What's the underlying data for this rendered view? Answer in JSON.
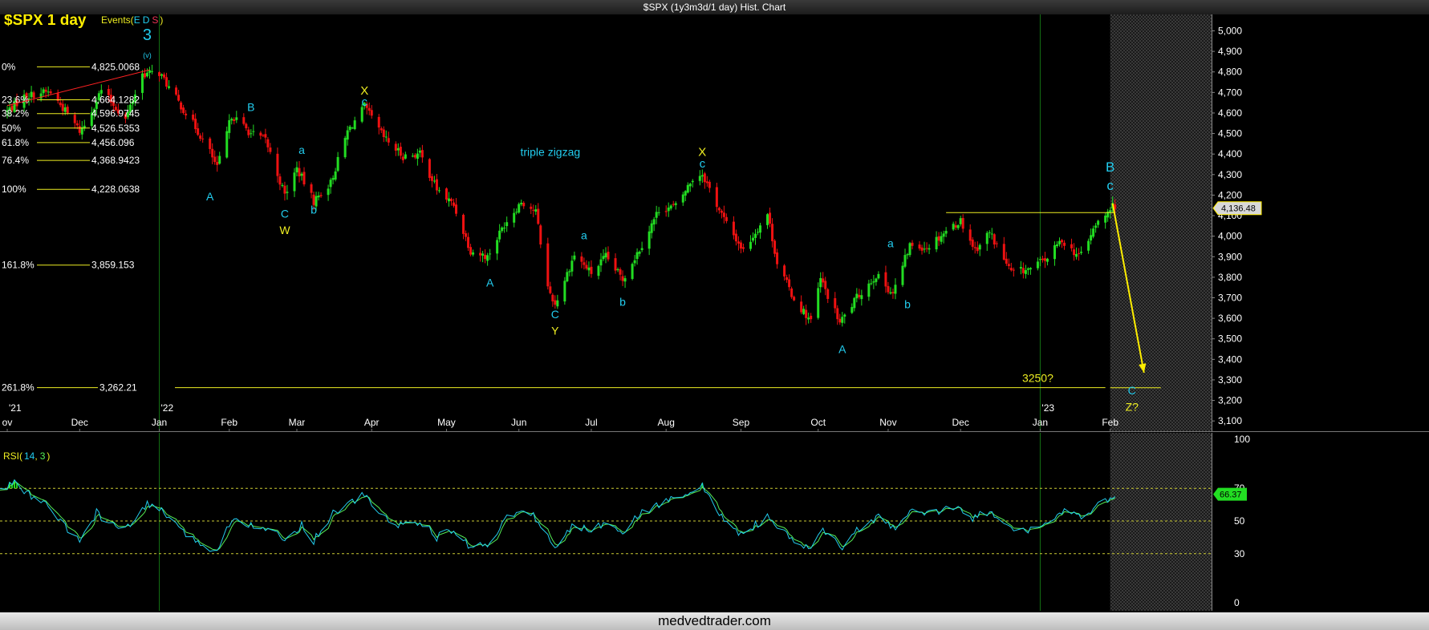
{
  "window": {
    "title": "$SPX (1y3m3d/1 day) Hist. Chart"
  },
  "footer": {
    "text": "medvedtrader.com"
  },
  "colors": {
    "up": "#22dd22",
    "down": "#ee1111",
    "annot_cyan": "#22ccee",
    "annot_yellow": "#eeee22",
    "grid_green": "#137013",
    "rsi_line": "#22ccee",
    "rsi_signal": "#55ee55"
  },
  "chart_data": [
    {
      "type": "candlestick",
      "title": "$SPX 1 day",
      "events_label": {
        "prefix": "Events(",
        "e": "E",
        "d": "D",
        "s": "S",
        "suffix": ")"
      },
      "ylim": [
        3050,
        5080
      ],
      "y_ticks": [
        {
          "value": 5000,
          "label": "5,000"
        },
        {
          "value": 4900,
          "label": "4,900"
        },
        {
          "value": 4800,
          "label": "4,800"
        },
        {
          "value": 4700,
          "label": "4,700"
        },
        {
          "value": 4600,
          "label": "4,600"
        },
        {
          "value": 4500,
          "label": "4,500"
        },
        {
          "value": 4400,
          "label": "4,400"
        },
        {
          "value": 4300,
          "label": "4,300"
        },
        {
          "value": 4200,
          "label": "4,200"
        },
        {
          "value": 4100,
          "label": "4,100"
        },
        {
          "value": 4000,
          "label": "4,000"
        },
        {
          "value": 3900,
          "label": "3,900"
        },
        {
          "value": 3800,
          "label": "3,800"
        },
        {
          "value": 3700,
          "label": "3,700"
        },
        {
          "value": 3600,
          "label": "3,600"
        },
        {
          "value": 3500,
          "label": "3,500"
        },
        {
          "value": 3400,
          "label": "3,400"
        },
        {
          "value": 3300,
          "label": "3,300"
        },
        {
          "value": 3200,
          "label": "3,200"
        },
        {
          "value": 3100,
          "label": "3,100"
        }
      ],
      "x_range": [
        "2021-10-29",
        "2023-03-15"
      ],
      "forecast_start": "2023-02-01",
      "x_ticks": [
        {
          "date": "2021-11-01",
          "label": "ov"
        },
        {
          "date": "2021-12-01",
          "label": "Dec"
        },
        {
          "date": "2022-01-03",
          "label": "Jan"
        },
        {
          "date": "2022-02-01",
          "label": "Feb"
        },
        {
          "date": "2022-03-01",
          "label": "Mar"
        },
        {
          "date": "2022-04-01",
          "label": "Apr"
        },
        {
          "date": "2022-05-02",
          "label": "May"
        },
        {
          "date": "2022-06-01",
          "label": "Jun"
        },
        {
          "date": "2022-07-01",
          "label": "Jul"
        },
        {
          "date": "2022-08-01",
          "label": "Aug"
        },
        {
          "date": "2022-09-01",
          "label": "Sep"
        },
        {
          "date": "2022-10-03",
          "label": "Oct"
        },
        {
          "date": "2022-11-01",
          "label": "Nov"
        },
        {
          "date": "2022-12-01",
          "label": "Dec"
        },
        {
          "date": "2023-01-03",
          "label": "Jan"
        },
        {
          "date": "2023-02-01",
          "label": "Feb"
        }
      ],
      "year_labels": [
        {
          "date": "2021-11-01",
          "label": "'21"
        },
        {
          "date": "2022-01-03",
          "label": "'22"
        },
        {
          "date": "2023-01-03",
          "label": "'23"
        }
      ],
      "year_lines": [
        "2022-01-03",
        "2023-01-03"
      ],
      "close_series": [
        [
          "2021-11-01",
          4610
        ],
        [
          "2021-11-08",
          4680
        ],
        [
          "2021-11-15",
          4700
        ],
        [
          "2021-11-19",
          4700
        ],
        [
          "2021-11-26",
          4595
        ],
        [
          "2021-12-01",
          4513
        ],
        [
          "2021-12-03",
          4540
        ],
        [
          "2021-12-10",
          4712
        ],
        [
          "2021-12-20",
          4570
        ],
        [
          "2021-12-27",
          4790
        ],
        [
          "2022-01-03",
          4796
        ],
        [
          "2022-01-10",
          4670
        ],
        [
          "2022-01-18",
          4530
        ],
        [
          "2022-01-24",
          4410
        ],
        [
          "2022-01-27",
          4330
        ],
        [
          "2022-02-02",
          4590
        ],
        [
          "2022-02-10",
          4500
        ],
        [
          "2022-02-16",
          4470
        ],
        [
          "2022-02-24",
          4200
        ],
        [
          "2022-03-01",
          4330
        ],
        [
          "2022-03-08",
          4170
        ],
        [
          "2022-03-15",
          4260
        ],
        [
          "2022-03-22",
          4510
        ],
        [
          "2022-03-29",
          4630
        ],
        [
          "2022-04-06",
          4480
        ],
        [
          "2022-04-14",
          4390
        ],
        [
          "2022-04-21",
          4400
        ],
        [
          "2022-04-28",
          4230
        ],
        [
          "2022-05-05",
          4150
        ],
        [
          "2022-05-12",
          3930
        ],
        [
          "2022-05-19",
          3900
        ],
        [
          "2022-05-26",
          4060
        ],
        [
          "2022-06-02",
          4170
        ],
        [
          "2022-06-08",
          4120
        ],
        [
          "2022-06-13",
          3750
        ],
        [
          "2022-06-16",
          3667
        ],
        [
          "2022-06-24",
          3910
        ],
        [
          "2022-07-01",
          3820
        ],
        [
          "2022-07-07",
          3900
        ],
        [
          "2022-07-14",
          3790
        ],
        [
          "2022-07-22",
          3960
        ],
        [
          "2022-07-29",
          4130
        ],
        [
          "2022-08-05",
          4145
        ],
        [
          "2022-08-12",
          4280
        ],
        [
          "2022-08-16",
          4305
        ],
        [
          "2022-08-23",
          4130
        ],
        [
          "2022-08-26",
          4060
        ],
        [
          "2022-09-02",
          3930
        ],
        [
          "2022-09-12",
          4110
        ],
        [
          "2022-09-16",
          3870
        ],
        [
          "2022-09-23",
          3693
        ],
        [
          "2022-09-30",
          3585
        ],
        [
          "2022-10-04",
          3790
        ],
        [
          "2022-10-12",
          3577
        ],
        [
          "2022-10-19",
          3700
        ],
        [
          "2022-10-27",
          3810
        ],
        [
          "2022-11-03",
          3720
        ],
        [
          "2022-11-10",
          3956
        ],
        [
          "2022-11-17",
          3946
        ],
        [
          "2022-11-25",
          4026
        ],
        [
          "2022-12-01",
          4076
        ],
        [
          "2022-12-07",
          3933
        ],
        [
          "2022-12-13",
          4020
        ],
        [
          "2022-12-22",
          3822
        ],
        [
          "2022-12-30",
          3840
        ],
        [
          "2023-01-06",
          3895
        ],
        [
          "2023-01-12",
          3983
        ],
        [
          "2023-01-19",
          3899
        ],
        [
          "2023-01-27",
          4070
        ],
        [
          "2023-02-01",
          4119
        ],
        [
          "2023-02-02",
          4179
        ],
        [
          "2023-02-03",
          4136
        ]
      ],
      "last_price": {
        "value": 4136.48,
        "label": "4,136.48"
      },
      "fib_levels": [
        {
          "pct": "0%",
          "value": 4825.0068,
          "label": "4,825.0068",
          "short": true
        },
        {
          "pct": "23.6%",
          "value": 4664.1282,
          "label": "4,664.1282",
          "short": true
        },
        {
          "pct": "38.2%",
          "value": 4596.9745,
          "label": "4,596.9745",
          "short": true
        },
        {
          "pct": "50%",
          "value": 4526.5353,
          "label": "4,526.5353",
          "short": true
        },
        {
          "pct": "61.8%",
          "value": 4456.096,
          "label": "4,456.096",
          "short": true
        },
        {
          "pct": "76.4%",
          "value": 4368.9423,
          "label": "4,368.9423",
          "short": true
        },
        {
          "pct": "100%",
          "value": 4228.0638,
          "label": "4,228.0638",
          "short": true
        },
        {
          "pct": "161.8%",
          "value": 3859.153,
          "label": "3,859.153",
          "short": true
        },
        {
          "pct": "261.8%",
          "value": 3262.21,
          "label": "3,262.21",
          "short": false
        }
      ],
      "horizontal_lines": [
        {
          "from": "2022-11-25",
          "to": "2023-02-03",
          "value": 4115
        },
        {
          "from": "2023-02-01",
          "to": "2023-02-22",
          "value": 3262
        }
      ],
      "trend_line": {
        "from": [
          "2021-11-01",
          4636
        ],
        "to": [
          "2021-12-30",
          4810
        ]
      },
      "forecast_arrow": {
        "from": [
          "2023-02-02",
          4160
        ],
        "to": [
          "2023-02-15",
          3335
        ]
      },
      "annotations": [
        {
          "text": "3",
          "date": "2021-12-29",
          "value": 4955,
          "color": "cyan",
          "size": 20
        },
        {
          "text": "(v)",
          "date": "2021-12-29",
          "value": 4870,
          "color": "cyan",
          "size": 9
        },
        {
          "text": "A",
          "date": "2022-01-24",
          "value": 4175,
          "color": "cyan",
          "size": 14
        },
        {
          "text": "B",
          "date": "2022-02-10",
          "value": 4610,
          "color": "cyan",
          "size": 14
        },
        {
          "text": "C",
          "date": "2022-02-24",
          "value": 4090,
          "color": "cyan",
          "size": 14
        },
        {
          "text": "W",
          "date": "2022-02-24",
          "value": 4010,
          "color": "yellow",
          "size": 14
        },
        {
          "text": "a",
          "date": "2022-03-03",
          "value": 4400,
          "color": "cyan",
          "size": 14
        },
        {
          "text": "b",
          "date": "2022-03-08",
          "value": 4110,
          "color": "cyan",
          "size": 14
        },
        {
          "text": "X",
          "date": "2022-03-29",
          "value": 4690,
          "color": "yellow",
          "size": 15
        },
        {
          "text": "c",
          "date": "2022-03-29",
          "value": 4635,
          "color": "cyan",
          "size": 15
        },
        {
          "text": "triple zigzag",
          "date": "2022-06-14",
          "value": 4390,
          "color": "cyan",
          "size": 14
        },
        {
          "text": "A",
          "date": "2022-05-20",
          "value": 3755,
          "color": "cyan",
          "size": 14
        },
        {
          "text": "a",
          "date": "2022-06-28",
          "value": 3985,
          "color": "cyan",
          "size": 14
        },
        {
          "text": "C",
          "date": "2022-06-16",
          "value": 3600,
          "color": "cyan",
          "size": 14
        },
        {
          "text": "Y",
          "date": "2022-06-16",
          "value": 3520,
          "color": "yellow",
          "size": 14
        },
        {
          "text": "b",
          "date": "2022-07-14",
          "value": 3660,
          "color": "cyan",
          "size": 14
        },
        {
          "text": "X",
          "date": "2022-08-16",
          "value": 4390,
          "color": "yellow",
          "size": 15
        },
        {
          "text": "c",
          "date": "2022-08-16",
          "value": 4335,
          "color": "cyan",
          "size": 15
        },
        {
          "text": "A",
          "date": "2022-10-13",
          "value": 3430,
          "color": "cyan",
          "size": 14
        },
        {
          "text": "a",
          "date": "2022-11-02",
          "value": 3945,
          "color": "cyan",
          "size": 14
        },
        {
          "text": "b",
          "date": "2022-11-09",
          "value": 3650,
          "color": "cyan",
          "size": 14
        },
        {
          "text": "B",
          "date": "2023-02-01",
          "value": 4315,
          "color": "cyan",
          "size": 17
        },
        {
          "text": "c",
          "date": "2023-02-01",
          "value": 4225,
          "color": "cyan",
          "size": 17
        },
        {
          "text": "3250?",
          "date": "2023-01-02",
          "value": 3290,
          "color": "yellow",
          "size": 14
        },
        {
          "text": "C",
          "date": "2023-02-10",
          "value": 3230,
          "color": "cyan",
          "size": 14
        },
        {
          "text": "Z?",
          "date": "2023-02-10",
          "value": 3150,
          "color": "yellow",
          "size": 14
        }
      ]
    },
    {
      "type": "line",
      "title": "RSI",
      "params_label": {
        "prefix": "RSI(",
        "p1": "14",
        "sep": ",",
        "p2": "3",
        "suffix": ")"
      },
      "ylim": [
        0,
        100
      ],
      "y_ticks": [
        {
          "value": 100,
          "label": "100"
        },
        {
          "value": 70,
          "label": "70"
        },
        {
          "value": 50,
          "label": "50"
        },
        {
          "value": 30,
          "label": "30"
        },
        {
          "value": 0,
          "label": "0"
        }
      ],
      "dashed_levels": [
        70,
        50,
        30
      ],
      "series": [
        {
          "data": [
            [
              "2021-10-29",
              68
            ],
            [
              "2021-11-04",
              74
            ],
            [
              "2021-11-10",
              66
            ],
            [
              "2021-11-19",
              58
            ],
            [
              "2021-11-26",
              44
            ],
            [
              "2021-12-01",
              38
            ],
            [
              "2021-12-08",
              55
            ],
            [
              "2021-12-14",
              48
            ],
            [
              "2021-12-20",
              44
            ],
            [
              "2021-12-29",
              60
            ],
            [
              "2022-01-04",
              57
            ],
            [
              "2022-01-12",
              43
            ],
            [
              "2022-01-19",
              38
            ],
            [
              "2022-01-26",
              30
            ],
            [
              "2022-02-02",
              52
            ],
            [
              "2022-02-10",
              48
            ],
            [
              "2022-02-16",
              46
            ],
            [
              "2022-02-24",
              38
            ],
            [
              "2022-03-03",
              48
            ],
            [
              "2022-03-08",
              38
            ],
            [
              "2022-03-16",
              55
            ],
            [
              "2022-03-29",
              66
            ],
            [
              "2022-04-06",
              52
            ],
            [
              "2022-04-14",
              47
            ],
            [
              "2022-04-21",
              50
            ],
            [
              "2022-04-28",
              40
            ],
            [
              "2022-05-05",
              44
            ],
            [
              "2022-05-12",
              34
            ],
            [
              "2022-05-19",
              36
            ],
            [
              "2022-05-27",
              52
            ],
            [
              "2022-06-03",
              56
            ],
            [
              "2022-06-08",
              52
            ],
            [
              "2022-06-16",
              33
            ],
            [
              "2022-06-24",
              48
            ],
            [
              "2022-07-01",
              44
            ],
            [
              "2022-07-08",
              50
            ],
            [
              "2022-07-14",
              44
            ],
            [
              "2022-07-22",
              55
            ],
            [
              "2022-08-01",
              62
            ],
            [
              "2022-08-10",
              68
            ],
            [
              "2022-08-16",
              71
            ],
            [
              "2022-08-23",
              54
            ],
            [
              "2022-09-01",
              42
            ],
            [
              "2022-09-12",
              52
            ],
            [
              "2022-09-22",
              38
            ],
            [
              "2022-09-30",
              33
            ],
            [
              "2022-10-05",
              44
            ],
            [
              "2022-10-13",
              34
            ],
            [
              "2022-10-21",
              47
            ],
            [
              "2022-10-28",
              52
            ],
            [
              "2022-11-04",
              44
            ],
            [
              "2022-11-10",
              56
            ],
            [
              "2022-11-18",
              54
            ],
            [
              "2022-11-30",
              60
            ],
            [
              "2022-12-06",
              52
            ],
            [
              "2022-12-13",
              56
            ],
            [
              "2022-12-22",
              44
            ],
            [
              "2022-12-30",
              45
            ],
            [
              "2023-01-06",
              49
            ],
            [
              "2023-01-13",
              56
            ],
            [
              "2023-01-19",
              52
            ],
            [
              "2023-01-27",
              60
            ],
            [
              "2023-02-01",
              62
            ],
            [
              "2023-02-03",
              66.37
            ]
          ]
        }
      ],
      "last_value": {
        "value": 66.37,
        "label": "66.37"
      }
    }
  ]
}
